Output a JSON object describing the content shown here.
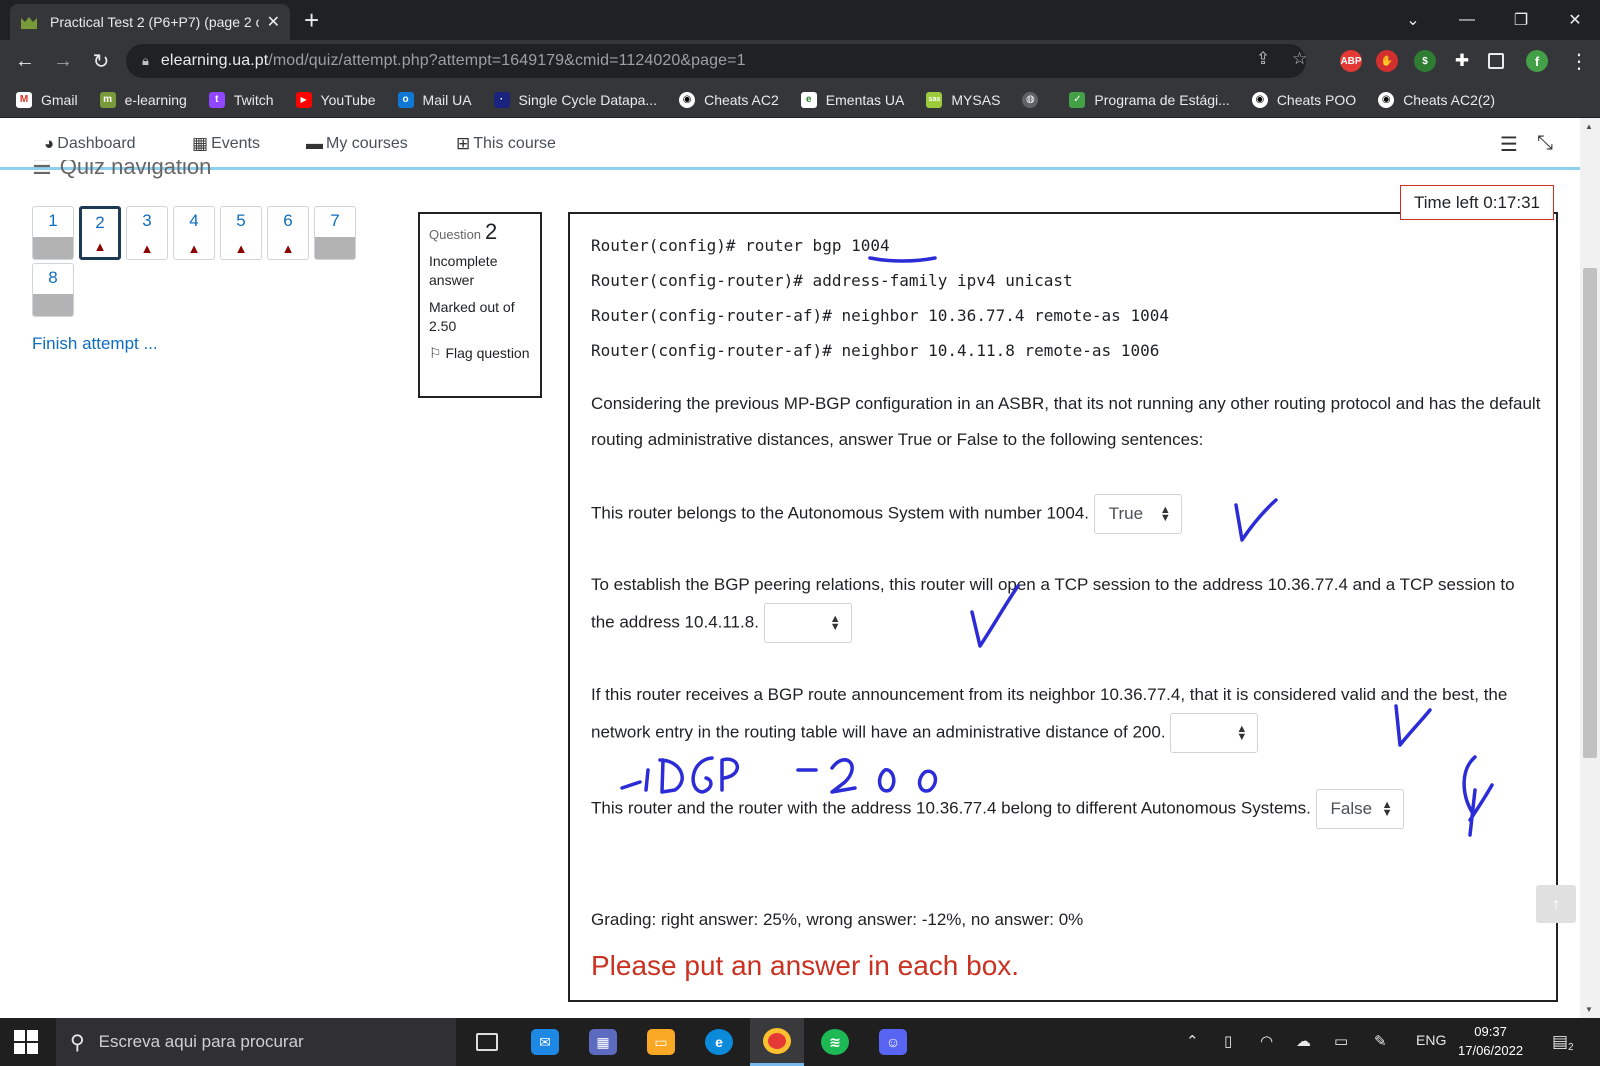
{
  "browser": {
    "tab_title": "Practical Test 2 (P6+P7) (page 2 o",
    "url_host": "elearning.ua.pt",
    "url_path": "/mod/quiz/attempt.php?attempt=1649179&cmid=1124020&page=1",
    "profile_initial": "f",
    "bookmarks": [
      "Gmail",
      "e-learning",
      "Twitch",
      "YouTube",
      "Mail UA",
      "Single Cycle Datapa...",
      "Cheats AC2",
      "Ementas UA",
      "MYSAS",
      "Programa de Estági...",
      "Cheats POO",
      "Cheats AC2(2)"
    ],
    "extension_abp": "ABP"
  },
  "moodle_nav": {
    "dashboard": "Dashboard",
    "events": "Events",
    "my_courses": "My courses",
    "this_course": "This course"
  },
  "quiz_nav": {
    "title": "Quiz navigation",
    "buttons": [
      "1",
      "2",
      "3",
      "4",
      "5",
      "6",
      "7",
      "8"
    ],
    "finish": "Finish attempt ..."
  },
  "question_info": {
    "label": "Question",
    "number": "2",
    "state": "Incomplete answer",
    "marks": "Marked out of 2.50",
    "flag": "Flag question"
  },
  "timer": "Time left 0:17:31",
  "question": {
    "code_lines": [
      "Router(config)# router bgp 1004",
      "Router(config-router)# address-family ipv4 unicast",
      "Router(config-router-af)# neighbor 10.36.77.4 remote-as 1004",
      "Router(config-router-af)# neighbor 10.4.11.8 remote-as 1006"
    ],
    "intro": "Considering the previous MP-BGP configuration in an ASBR, that its not running any other routing protocol and has the default routing administrative distances, answer True or False to the following sentences:",
    "statements": [
      {
        "text": "This router belongs to the Autonomous System with number 1004.",
        "selected": "True"
      },
      {
        "text": "To establish the BGP peering relations, this router will open a TCP session to the address 10.36.77.4 and a TCP session to the address 10.4.11.8.",
        "selected": ""
      },
      {
        "text": "If this router receives a BGP route announcement from its neighbor 10.36.77.4, that it is considered valid and the best, the network entry in the routing table will have an administrative distance of 200.",
        "selected": ""
      },
      {
        "text": "This router and the router with the address 10.36.77.4 belong to different Autonomous Systems.",
        "selected": "False"
      }
    ],
    "grading": "Grading: right answer: 25%, wrong answer: -12%, no answer: 0%",
    "validation": "Please put an answer in each box."
  },
  "taskbar": {
    "search_placeholder": "Escreva aqui para procurar",
    "language": "ENG",
    "time": "09:37",
    "date": "17/06/2022",
    "notifications": "2"
  },
  "colors": {
    "accent": "#0f6cbf",
    "error": "#ca3120",
    "ink": "#2b2bd8",
    "nav_underline": "#8fd0ef"
  }
}
